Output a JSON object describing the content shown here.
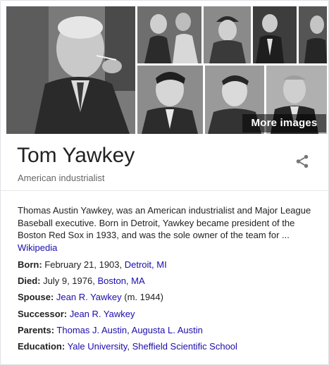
{
  "gallery": {
    "more_images_label": "More images"
  },
  "entity": {
    "name": "Tom Yawkey",
    "subtitle": "American industrialist"
  },
  "description": {
    "text": "Thomas Austin Yawkey, was an American industrialist and Major League Baseball executive. Born in Detroit, Yawkey became president of the Boston Red Sox in 1933, and was the sole owner of the team for ... ",
    "source": "Wikipedia"
  },
  "facts": {
    "born": {
      "label": "Born:",
      "text": " February 21, 1903, ",
      "link": "Detroit, MI"
    },
    "died": {
      "label": "Died:",
      "text": " July 9, 1976, ",
      "link": "Boston, MA"
    },
    "spouse": {
      "label": "Spouse:",
      "link": "Jean R. Yawkey",
      "suffix": " (m. 1944)"
    },
    "successor": {
      "label": "Successor:",
      "link": "Jean R. Yawkey"
    },
    "parents": {
      "label": "Parents:",
      "link1": "Thomas J. Austin",
      "sep": ", ",
      "link2": "Augusta L. Austin"
    },
    "education": {
      "label": "Education:",
      "link1": "Yale University",
      "sep": ", ",
      "link2": "Sheffield Scientific School"
    }
  }
}
